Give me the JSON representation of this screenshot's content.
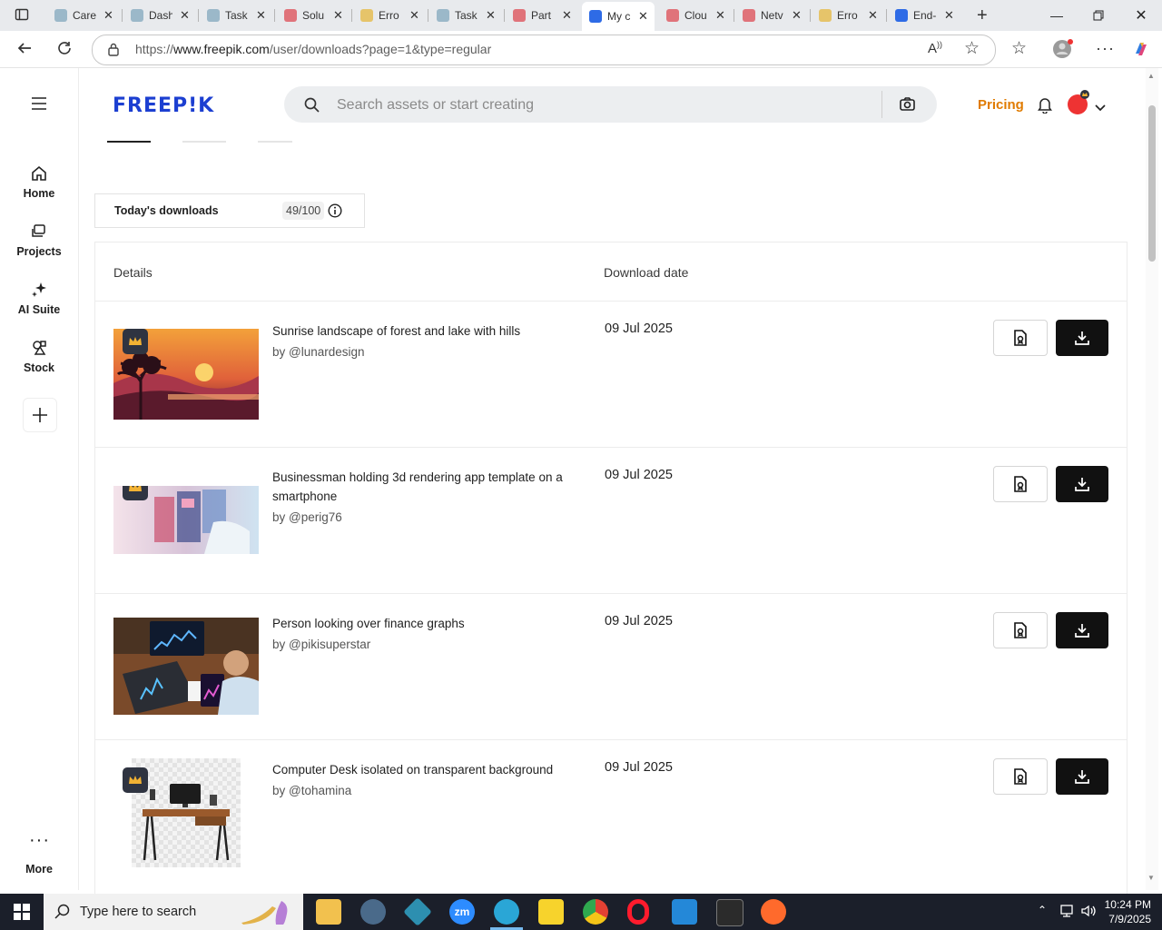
{
  "browser": {
    "tabs": [
      {
        "title": "Care",
        "color": "#9bb8c9"
      },
      {
        "title": "Dash",
        "color": "#9bb8c9"
      },
      {
        "title": "Task",
        "color": "#9bb8c9"
      },
      {
        "title": "Solu",
        "color": "#e0737a"
      },
      {
        "title": "Erro",
        "color": "#e6c46a"
      },
      {
        "title": "Task",
        "color": "#9bb8c9"
      },
      {
        "title": "Part",
        "color": "#e0737a"
      },
      {
        "title": "My c",
        "color": "#2e6be6"
      },
      {
        "title": "Clou",
        "color": "#e0737a"
      },
      {
        "title": "Netv",
        "color": "#e0737a"
      },
      {
        "title": "Erro",
        "color": "#e6c46a"
      },
      {
        "title": "End-",
        "color": "#2e6be6"
      }
    ],
    "url_prefix": "https://",
    "url_host": "www.freepik.com",
    "url_path": "/user/downloads?page=1&type=regular"
  },
  "rail": {
    "items": [
      {
        "label": "Home"
      },
      {
        "label": "Projects"
      },
      {
        "label": "AI Suite"
      },
      {
        "label": "Stock"
      }
    ],
    "more_label": "More"
  },
  "header": {
    "logo": "FREEP!K",
    "search_placeholder": "Search assets or start creating",
    "pricing": "Pricing"
  },
  "counter": {
    "label": "Today's downloads",
    "value": "49/100"
  },
  "table": {
    "col_details": "Details",
    "col_date": "Download date",
    "rows": [
      {
        "title": "Sunrise landscape of forest and lake with hills",
        "author": "by @lunardesign",
        "date": "09 Jul 2025"
      },
      {
        "title": "Businessman holding 3d rendering app template on a smartphone",
        "author": "by @perig76",
        "date": "09 Jul 2025"
      },
      {
        "title": "Person looking over finance graphs",
        "author": "by @pikisuperstar",
        "date": "09 Jul 2025"
      },
      {
        "title": "Computer Desk isolated on transparent background",
        "author": "by @tohamina",
        "date": "09 Jul 2025"
      }
    ]
  },
  "taskbar": {
    "search_text": "Type here to search",
    "time": "10:24 PM",
    "date": "7/9/2025"
  },
  "colors": {
    "brand": "#1c3fd1",
    "pricing": "#e07b00",
    "download_button": "#111111"
  }
}
